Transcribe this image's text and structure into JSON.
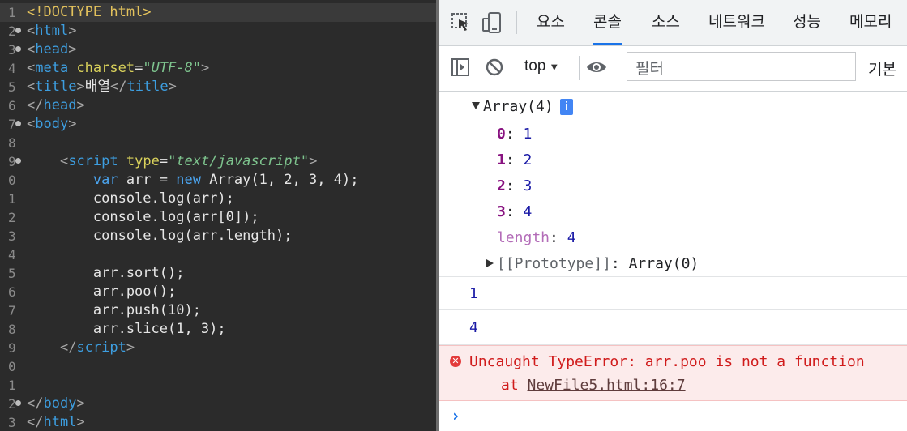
{
  "editor": {
    "lines": [
      {
        "n": "1",
        "fold": false,
        "code": [
          [
            "doc",
            "<!DOCTYPE html>"
          ]
        ]
      },
      {
        "n": "2",
        "fold": true,
        "code": [
          [
            "br",
            "<"
          ],
          [
            "tag",
            "html"
          ],
          [
            "br",
            ">"
          ]
        ]
      },
      {
        "n": "3",
        "fold": true,
        "code": [
          [
            "br",
            "<"
          ],
          [
            "tag",
            "head"
          ],
          [
            "br",
            ">"
          ]
        ]
      },
      {
        "n": "4",
        "fold": false,
        "code": [
          [
            "br",
            "<"
          ],
          [
            "tag",
            "meta "
          ],
          [
            "attr",
            "charset"
          ],
          [
            "txt",
            "="
          ],
          [
            "str",
            "\"UTF-8\""
          ],
          [
            "br",
            ">"
          ]
        ]
      },
      {
        "n": "5",
        "fold": false,
        "code": [
          [
            "br",
            "<"
          ],
          [
            "tag",
            "title"
          ],
          [
            "br",
            ">"
          ],
          [
            "txt",
            "배열"
          ],
          [
            "br",
            "</"
          ],
          [
            "tag",
            "title"
          ],
          [
            "br",
            ">"
          ]
        ]
      },
      {
        "n": "6",
        "fold": false,
        "code": [
          [
            "br",
            "</"
          ],
          [
            "tag",
            "head"
          ],
          [
            "br",
            ">"
          ]
        ]
      },
      {
        "n": "7",
        "fold": true,
        "code": [
          [
            "br",
            "<"
          ],
          [
            "tag",
            "body"
          ],
          [
            "br",
            ">"
          ]
        ]
      },
      {
        "n": "8",
        "fold": false,
        "code": []
      },
      {
        "n": "9",
        "fold": true,
        "code": [
          [
            "txt",
            "    "
          ],
          [
            "br",
            "<"
          ],
          [
            "tag",
            "script "
          ],
          [
            "attr",
            "type"
          ],
          [
            "txt",
            "="
          ],
          [
            "str",
            "\"text/javascript\""
          ],
          [
            "br",
            ">"
          ]
        ]
      },
      {
        "n": "0",
        "fold": false,
        "code": [
          [
            "txt",
            "        "
          ],
          [
            "kw",
            "var"
          ],
          [
            "txt",
            " arr = "
          ],
          [
            "kw",
            "new"
          ],
          [
            "txt",
            " Array(1, 2, 3, 4);"
          ]
        ]
      },
      {
        "n": "1",
        "fold": false,
        "code": [
          [
            "txt",
            "        console.log(arr);"
          ]
        ]
      },
      {
        "n": "2",
        "fold": false,
        "code": [
          [
            "txt",
            "        console.log(arr[0]);"
          ]
        ]
      },
      {
        "n": "3",
        "fold": false,
        "code": [
          [
            "txt",
            "        console.log(arr.length);"
          ]
        ]
      },
      {
        "n": "4",
        "fold": false,
        "code": []
      },
      {
        "n": "5",
        "fold": false,
        "code": [
          [
            "txt",
            "        arr.sort();"
          ]
        ]
      },
      {
        "n": "6",
        "fold": false,
        "code": [
          [
            "txt",
            "        arr.poo();"
          ]
        ]
      },
      {
        "n": "7",
        "fold": false,
        "code": [
          [
            "txt",
            "        arr.push(10);"
          ]
        ]
      },
      {
        "n": "8",
        "fold": false,
        "code": [
          [
            "txt",
            "        arr.slice(1, 3);"
          ]
        ]
      },
      {
        "n": "9",
        "fold": false,
        "code": [
          [
            "txt",
            "    "
          ],
          [
            "br",
            "</"
          ],
          [
            "tag",
            "script"
          ],
          [
            "br",
            ">"
          ]
        ]
      },
      {
        "n": "0",
        "fold": false,
        "code": []
      },
      {
        "n": "1",
        "fold": false,
        "code": []
      },
      {
        "n": "2",
        "fold": true,
        "code": [
          [
            "br",
            "</"
          ],
          [
            "tag",
            "body"
          ],
          [
            "br",
            ">"
          ]
        ]
      },
      {
        "n": "3",
        "fold": false,
        "code": [
          [
            "br",
            "</"
          ],
          [
            "tag",
            "html"
          ],
          [
            "br",
            ">"
          ]
        ]
      }
    ]
  },
  "devtools": {
    "tabs": [
      "요소",
      "콘솔",
      "소스",
      "네트워크",
      "성능",
      "메모리"
    ],
    "active_tab": "콘솔",
    "context": "top",
    "filter_placeholder": "필터",
    "levels_label": "기본",
    "colors": {
      "accent": "#1a73e8",
      "error": "#d01b1b",
      "error_bg": "#fcebeb"
    }
  },
  "console": {
    "array_header": "Array(4)",
    "info_badge": "i",
    "props": [
      {
        "key": "0",
        "val": "1"
      },
      {
        "key": "1",
        "val": "2"
      },
      {
        "key": "2",
        "val": "3"
      },
      {
        "key": "3",
        "val": "4"
      }
    ],
    "length_key": "length",
    "length_val": "4",
    "proto_name": "[[Prototype]]",
    "proto_val": "Array(0)",
    "log1": "1",
    "log2": "4",
    "error_text": "Uncaught TypeError: arr.poo is not a function",
    "error_at": "at ",
    "error_link": "NewFile5.html:16:7",
    "prompt": "›"
  }
}
